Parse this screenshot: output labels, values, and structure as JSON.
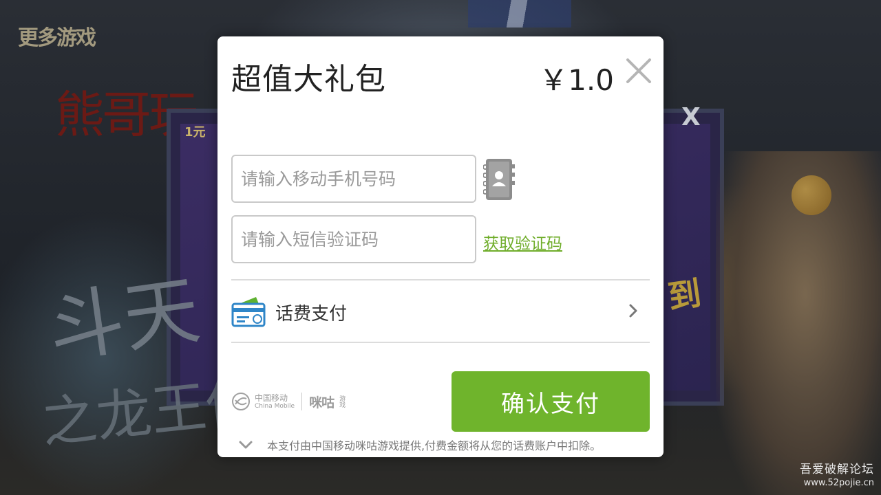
{
  "background": {
    "more_games": "更多游戏",
    "red_title": "熊哥玩",
    "panel_price": "1元",
    "panel_close": "X",
    "calligraphy_top": "斗天",
    "calligraphy_bottom": "之龙王传",
    "yellow_text": "到"
  },
  "dialog": {
    "title": "超值大礼包",
    "price": "￥1.0",
    "phone_placeholder": "请输入移动手机号码",
    "code_placeholder": "请输入短信验证码",
    "get_code_label": "获取验证码",
    "payment_method": "话费支付",
    "brand_cm_zh": "中国移动",
    "brand_cm_en": "China Mobile",
    "brand_migu": "咪咕",
    "brand_migu_small": "游戏",
    "confirm_label": "确认支付",
    "footnote": "本支付由中国移动咪咕游戏提供,付费金额将从您的话费账户中扣除。"
  },
  "watermark": {
    "title": "吾爱破解论坛",
    "url": "www.52pojie.cn"
  },
  "colors": {
    "accent_green": "#6fb42c",
    "link_green": "#6fad2a"
  }
}
